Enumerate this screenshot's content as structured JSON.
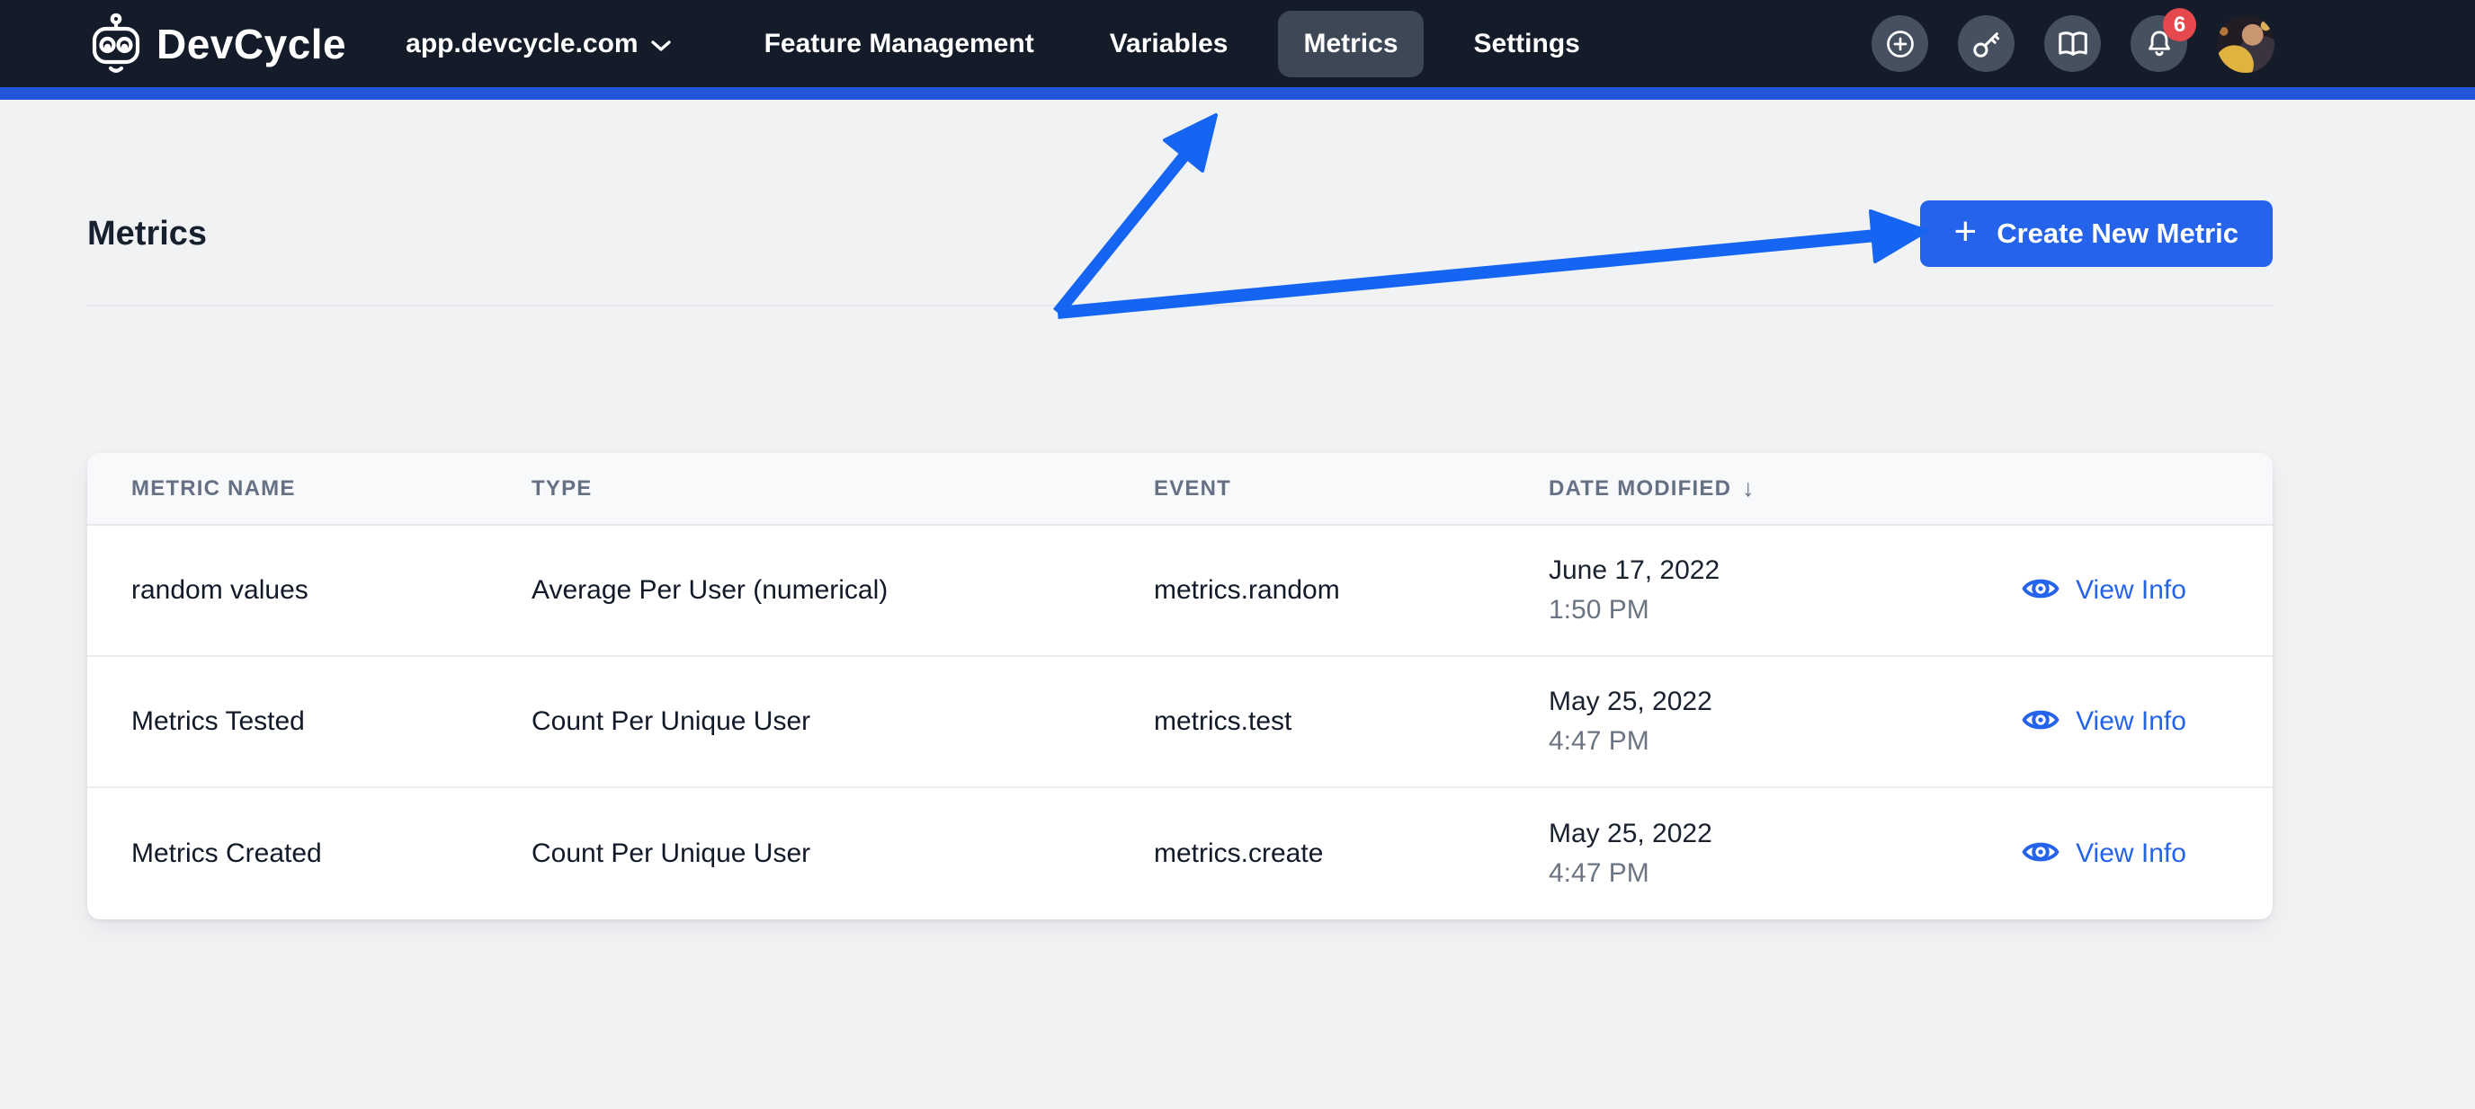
{
  "nav": {
    "brand": "DevCycle",
    "org_selector": "app.devcycle.com",
    "items": [
      {
        "label": "Feature Management",
        "active": false
      },
      {
        "label": "Variables",
        "active": false
      },
      {
        "label": "Metrics",
        "active": true
      },
      {
        "label": "Settings",
        "active": false
      }
    ],
    "notification_count": "6"
  },
  "icons": {
    "logo": "robot",
    "org_chevron": "chevron-down",
    "add": "plus-circle",
    "api_key": "key",
    "docs": "open-book",
    "notifications": "bell",
    "view_info": "eye",
    "plus_glyph": "+",
    "sort_glyph": "↓"
  },
  "page": {
    "title": "Metrics",
    "create_button_label": "Create New Metric"
  },
  "table": {
    "headers": {
      "name": "Metric Name",
      "type": "Type",
      "event": "Event",
      "date_modified": "Date Modified"
    },
    "view_info_label": "View Info",
    "rows": [
      {
        "name": "random values",
        "type": "Average Per User (numerical)",
        "event": "metrics.random",
        "date": "June 17, 2022",
        "time": "1:50 PM"
      },
      {
        "name": "Metrics Tested",
        "type": "Count Per Unique User",
        "event": "metrics.test",
        "date": "May 25, 2022",
        "time": "4:47 PM"
      },
      {
        "name": "Metrics Created",
        "type": "Count Per Unique User",
        "event": "metrics.create",
        "date": "May 25, 2022",
        "time": "4:47 PM"
      }
    ]
  },
  "colors": {
    "nav_bg": "#141b29",
    "nav_active_pill": "#3e4755",
    "accent_bar": "#2355d9",
    "page_bg": "#f1f2f4",
    "primary_button": "#2563eb",
    "annotation_arrow": "#1565f2",
    "link_blue": "#2563eb",
    "badge_red": "#e5484d",
    "text_dark": "#121a29",
    "text_gray": "#667085"
  }
}
